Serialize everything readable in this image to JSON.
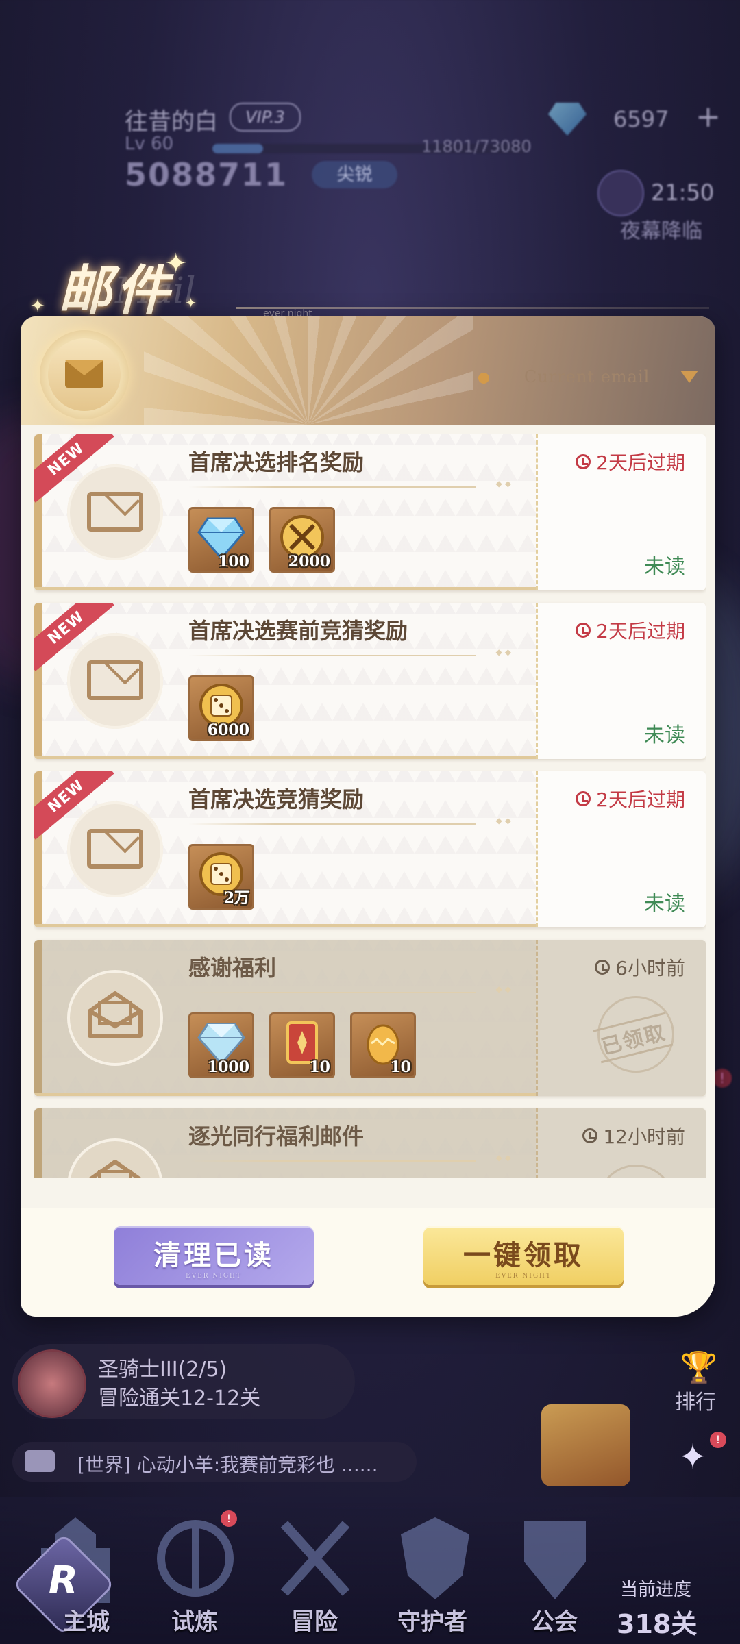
{
  "hud": {
    "player_name": "往昔的白",
    "vip": "VIP.3",
    "level": "Lv 60",
    "exp": "11801/73080",
    "exp_progress": 0.16,
    "power": "5088711",
    "rank": "尖锐",
    "currency": "6597",
    "currency_plus": "+",
    "timer": "21:50",
    "event_name": "夜幕降临"
  },
  "title": {
    "text": "邮件",
    "en_text": "Mail",
    "tag": "ever night"
  },
  "header": {
    "filter_label": "Current email"
  },
  "mails": [
    {
      "title": "首席决选排名奖励",
      "badge": "NEW",
      "expiry": "2天后过期",
      "status": "未读",
      "read": false,
      "items": [
        {
          "icon": "diamond-icon",
          "qty": "100"
        },
        {
          "icon": "crossed-swords-coin-icon",
          "qty": "2000"
        }
      ]
    },
    {
      "title": "首席决选赛前竞猜奖励",
      "badge": "NEW",
      "expiry": "2天后过期",
      "status": "未读",
      "read": false,
      "items": [
        {
          "icon": "dice-coin-icon",
          "qty": "6000"
        }
      ]
    },
    {
      "title": "首席决选竞猜奖励",
      "badge": "NEW",
      "expiry": "2天后过期",
      "status": "未读",
      "read": false,
      "items": [
        {
          "icon": "dice-coin-icon",
          "qty": "2万"
        }
      ]
    },
    {
      "title": "感谢福利",
      "badge": "",
      "expiry": "6小时前",
      "status": "已领取",
      "read": true,
      "items": [
        {
          "icon": "diamond-icon",
          "qty": "1000"
        },
        {
          "icon": "summon-card-icon",
          "qty": "10"
        },
        {
          "icon": "golden-egg-icon",
          "qty": "10"
        }
      ]
    },
    {
      "title": "逐光同行福利邮件",
      "badge": "",
      "expiry": "12小时前",
      "status": "",
      "read": true,
      "items": []
    }
  ],
  "footer": {
    "clear_label": "清理已读",
    "claim_label": "一键领取",
    "button_sub": "EVER NIGHT"
  },
  "bottom": {
    "quest_title": "圣骑士III(2/5)",
    "quest_sub": "冒险通关12-12关",
    "rank_label": "排行",
    "chat_text": "[世界] 心动小羊:我赛前竞彩也 ......",
    "stage_label": "当前进度",
    "stage_count": "318关",
    "nav": [
      "主城",
      "试炼",
      "冒险",
      "守护者",
      "公会"
    ],
    "trial_badge": "!"
  },
  "colors": {
    "expiry_red": "#c33a45",
    "unread_green": "#3f8a55",
    "new_ribbon": "#d44a58",
    "claim_gold": "#f0cf63",
    "clear_purple": "#8f7fd9"
  }
}
